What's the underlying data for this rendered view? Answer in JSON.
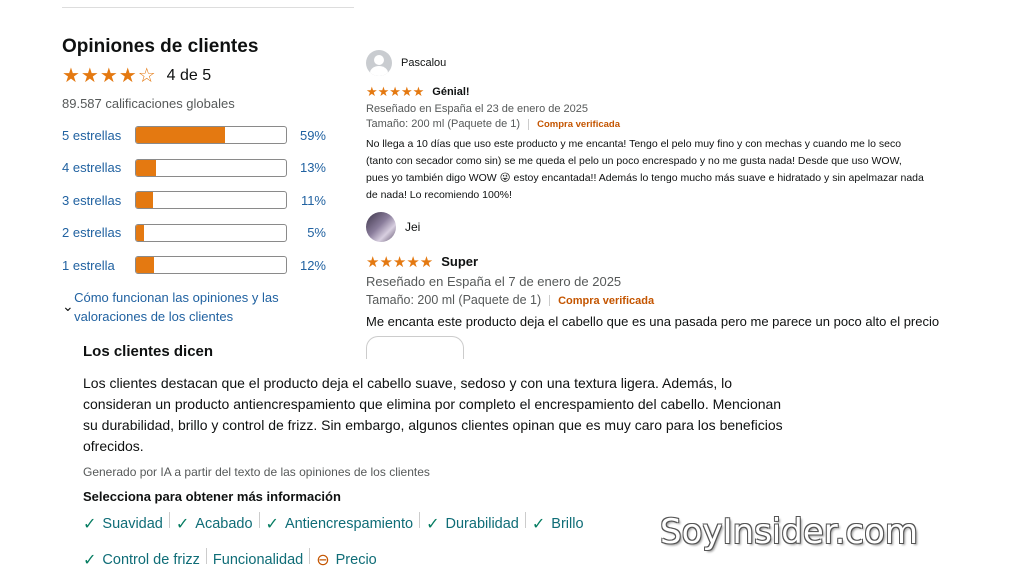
{
  "ratings": {
    "title": "Opiniones de clientes",
    "stars": "★★★★☆",
    "overall": "4 de 5",
    "total": "89.587 calificaciones globales",
    "histogram": [
      {
        "label": "5 estrellas",
        "pct": "59%",
        "fill": 0.59
      },
      {
        "label": "4 estrellas",
        "pct": "13%",
        "fill": 0.13
      },
      {
        "label": "3 estrellas",
        "pct": "11%",
        "fill": 0.11
      },
      {
        "label": "2 estrellas",
        "pct": "5%",
        "fill": 0.05
      },
      {
        "label": "1 estrella",
        "pct": "12%",
        "fill": 0.12
      }
    ],
    "how_link": "Cómo funcionan las opiniones y las valoraciones de los clientes",
    "accent_color": "#e47911"
  },
  "reviews": [
    {
      "name": "Pascalou",
      "stars": "★★★★★",
      "title": "Génial!",
      "meta": "Reseñado en España el 23 de enero de 2025",
      "variant": "Tamaño: 200 ml (Paquete de 1)",
      "verified": "Compra verificada",
      "body": "No llega a 10 días que uso este producto y me encanta! Tengo el pelo muy fino y con mechas y cuando me lo seco (tanto con secador como sin) se me queda el pelo un poco encrespado y no me gusta nada! Desde que uso WOW, pues yo también digo WOW 😜 estoy encantada!! Además lo tengo mucho más suave e hidratado y sin apelmazar nada de nada! Lo recomiendo 100%!"
    },
    {
      "name": "Jei",
      "stars": "★★★★★",
      "title": "Super",
      "meta": "Reseñado en España el 7 de enero de 2025",
      "variant": "Tamaño: 200 ml (Paquete de 1)",
      "verified": "Compra verificada",
      "body": "Me encanta este producto deja el cabello que es una pasada pero me parece un poco alto el precio"
    }
  ],
  "customers_say": {
    "title": "Los clientes dicen",
    "summary": "Los clientes destacan que el producto deja el cabello suave, sedoso y con una textura ligera. Además, lo consideran un producto antiencrespamiento que elimina por completo el encrespamiento del cabello. Mencionan su durabilidad, brillo y control de frizz. Sin embargo, algunos clientes opinan que es muy caro para los beneficios ofrecidos.",
    "ai_note": "Generado por IA a partir del texto de las opiniones de los clientes",
    "select_label": "Selecciona para obtener más información",
    "aspects": [
      {
        "label": "Suavidad",
        "icon": "✓",
        "sentiment": "positive"
      },
      {
        "label": "Acabado",
        "icon": "✓",
        "sentiment": "positive"
      },
      {
        "label": "Antiencrespamiento",
        "icon": "✓",
        "sentiment": "positive"
      },
      {
        "label": "Durabilidad",
        "icon": "✓",
        "sentiment": "positive"
      },
      {
        "label": "Brillo",
        "icon": "✓",
        "sentiment": "positive"
      },
      {
        "label": "Control de frizz",
        "icon": "✓",
        "sentiment": "positive"
      },
      {
        "label": "Funcionalidad",
        "icon": "",
        "sentiment": "mixed"
      },
      {
        "label": "Precio",
        "icon": "⊖",
        "sentiment": "negative"
      }
    ]
  },
  "watermark": "SoyInsider.com"
}
